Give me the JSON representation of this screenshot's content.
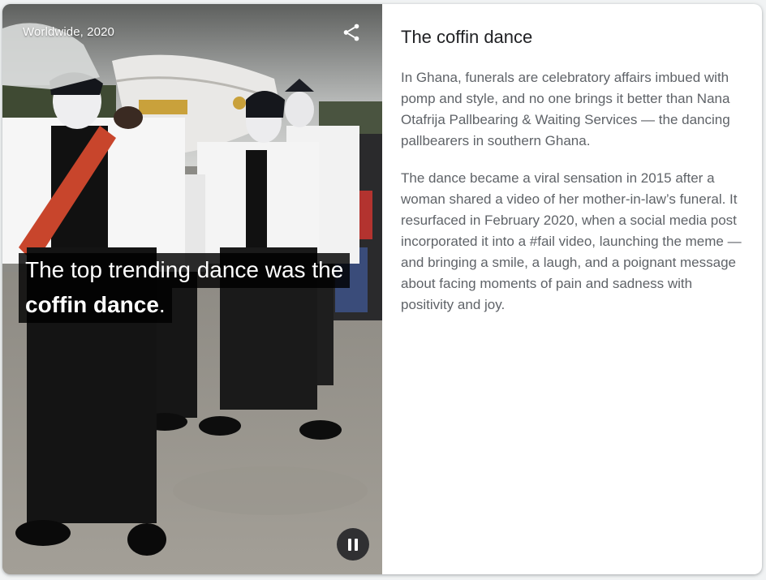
{
  "video": {
    "location_label": "Worldwide, 2020",
    "caption_line1": "The top trending dance was the",
    "caption_line2_bold": "coffin dance",
    "caption_line2_end": ".",
    "share_icon": "share-icon",
    "pause_icon": "pause-icon"
  },
  "article": {
    "title": "The coffin dance",
    "paragraph1": "In Ghana, funerals are celebratory affairs imbued with pomp and style, and no one brings it better than Nana Otafrija Pallbearing & Waiting Services — the dancing pallbearers in southern Ghana.",
    "paragraph2": "The dance became a viral sensation in 2015 after a woman shared a video of her mother-in-law’s funeral. It resurfaced in February 2020, when a social media post incorporated it into a #fail video, launching the meme — and bringing a smile, a laugh, and a poignant message about facing moments of pain and sadness with positivity and joy."
  },
  "colors": {
    "title": "#202124",
    "body_text": "#5f6368",
    "caption_bg": "#000000",
    "pause_bg": "#202124"
  }
}
